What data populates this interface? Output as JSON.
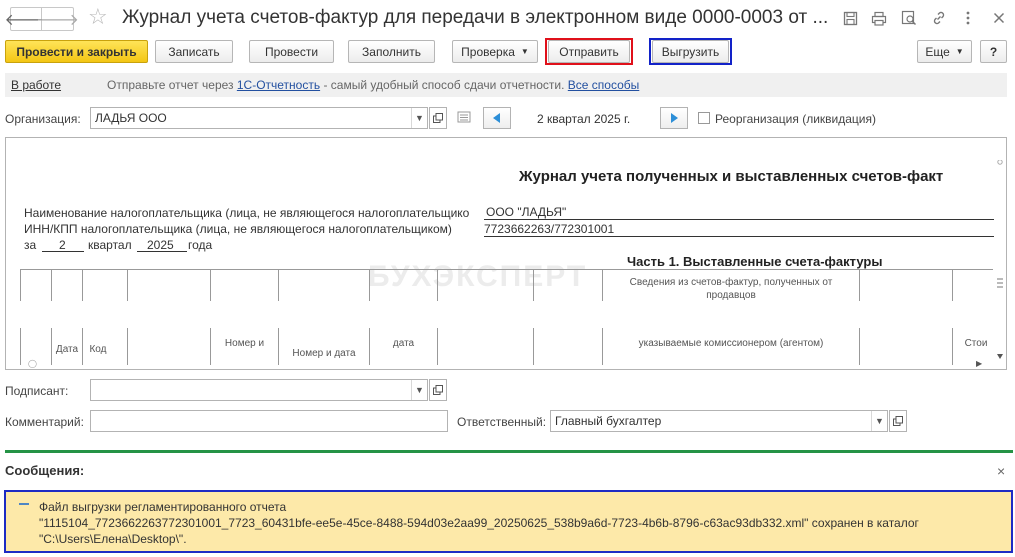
{
  "window": {
    "title": "Журнал учета счетов-фактур для передачи в электронном виде 0000-0003 от ...",
    "back_glyph": "🡐",
    "forward_glyph": "🡒",
    "star_glyph": "☆",
    "icons": [
      "save-icon",
      "print-icon",
      "preview-icon",
      "link-icon",
      "more-vertical-icon",
      "close-icon"
    ]
  },
  "toolbar": {
    "post_close": "Провести и закрыть",
    "save": "Записать",
    "post": "Провести",
    "fill": "Заполнить",
    "check": "Проверка",
    "send": "Отправить",
    "export": "Выгрузить",
    "more": "Еще",
    "help": "?"
  },
  "infobar": {
    "status": "В работе",
    "msg_prefix": "Отправьте отчет через ",
    "msg_link": "1С-Отчетность",
    "msg_middle": " - самый удобный способ сдачи отчетности. ",
    "msg_link2": "Все способы"
  },
  "org": {
    "label": "Организация:",
    "value": "ЛАДЬЯ ООО",
    "period": "2 квартал 2025 г.",
    "reorg_label": "Реорганизация (ликвидация)"
  },
  "report": {
    "title": "Журнал учета полученных и выставленных счетов-факт",
    "line1": "Наименование налогоплательщика (лица, не являющегося налогоплательщико",
    "line1_value": "ООО \"ЛАДЬЯ\"",
    "line2": "ИНН/КПП налогоплательщика (лица, не являющегося налогоплательщиком)",
    "line2_value": "7723662263/772301001",
    "period_prefix": "за",
    "quarter": "2",
    "quarter_label": "квартал",
    "year": "2025",
    "year_label": "года",
    "part1": "Часть 1. Выставленные счета-фактуры",
    "watermark": "БУХЭКСПЕРТ",
    "header_info1": "Сведения из счетов-фактур, полученных от",
    "header_info1b": "продавцов",
    "col_date": "Дата",
    "col_code": "Код",
    "col_number": "Номер и",
    "col_number2": "Номер и дата",
    "col_date2": "дата",
    "col_agent": "указываемые комиссионером (агентом)",
    "col_cost": "Стои"
  },
  "bottom": {
    "signer_label": "Подписант:",
    "signer_value": "",
    "comment_label": "Комментарий:",
    "comment_value": "",
    "resp_label": "Ответственный:",
    "resp_value": "Главный бухгалтер"
  },
  "messages": {
    "title": "Сообщения:",
    "close": "×",
    "line1": "Файл выгрузки регламентированного отчета",
    "line2": "\"1115104_7723662263772301001_7723_60431bfe-ee5e-45ce-8488-594d03e2aa99_20250625_538b9a6d-7723-4b6b-8796-c63ac93db332.xml\" сохранен в каталог",
    "line3": "\"C:\\Users\\Елена\\Desktop\\\"."
  },
  "colors": {
    "primary_yellow": "#f3c614",
    "highlight_red": "#e0101a",
    "highlight_blue": "#1222c8",
    "message_bg": "#fde9a9",
    "separator_green": "#259346",
    "link_blue": "#2350a0"
  }
}
